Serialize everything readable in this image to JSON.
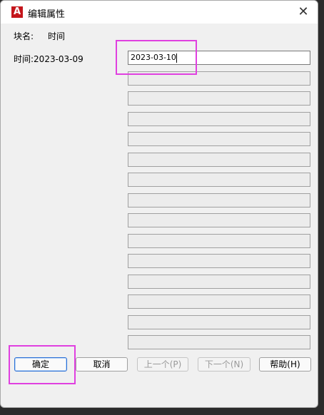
{
  "window": {
    "title": "编辑属性",
    "app_icon": "A"
  },
  "close_glyph": "✕",
  "block": {
    "label": "块名:",
    "name": "时间"
  },
  "attribute": {
    "label": "时间:",
    "default_value": "2023-03-09",
    "input_value": "2023-03-10"
  },
  "buttons": {
    "ok": "确定",
    "cancel": "取消",
    "prev": "上一个(P)",
    "next": "下一个(N)",
    "help": "帮助(H)"
  },
  "colors": {
    "highlight": "#e040e0",
    "app_icon_bg": "#c4161c"
  }
}
